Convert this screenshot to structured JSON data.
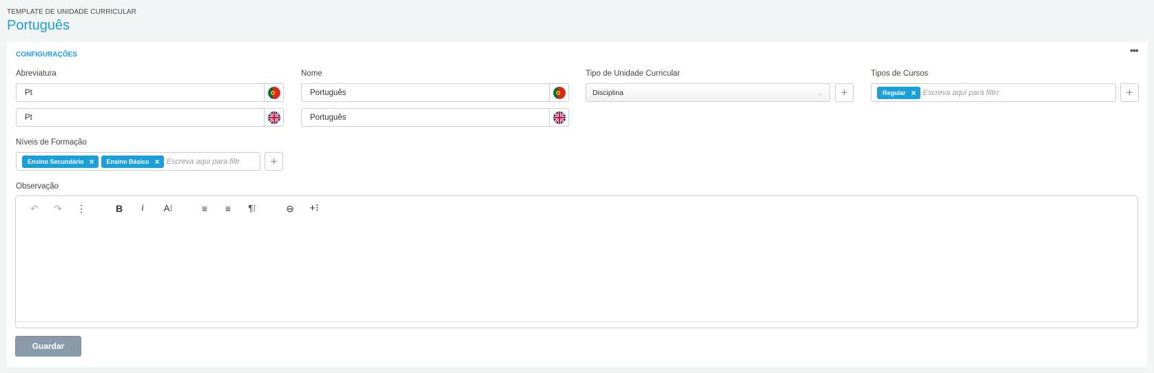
{
  "header": {
    "eyebrow": "TEMPLATE DE UNIDADE CURRICULAR",
    "title": "Português"
  },
  "section": {
    "title": "CONFIGURAÇÕES",
    "menu_icon": "more-horizontal-icon"
  },
  "abreviatura": {
    "label": "Abreviatura",
    "pt_value": "Pt",
    "en_value": "Pt"
  },
  "nome": {
    "label": "Nome",
    "pt_value": "Português",
    "en_value": "Português"
  },
  "tipo_unidade": {
    "label": "Tipo de Unidade Curricular",
    "selected": "Disciplina"
  },
  "tipos_cursos": {
    "label": "Tipos de Cursos",
    "tags": [
      "Regular"
    ],
    "placeholder": "Escreva aqui para filtrar"
  },
  "niveis_formacao": {
    "label": "Níveis de Formação",
    "tags": [
      "Ensino Secundário",
      "Ensino Básico"
    ],
    "placeholder": "Escreva aqui para filtrar"
  },
  "observacao": {
    "label": "Observação",
    "toolbar": {
      "undo": "↶",
      "redo": "↷",
      "more": "⋮",
      "bold": "B",
      "italic": "i",
      "font_size": "A⁝",
      "align": "≡",
      "list": "≡",
      "paragraph": "¶⁝",
      "link": "⊖",
      "insert": "+⁝"
    }
  },
  "actions": {
    "save_label": "Guardar"
  },
  "colors": {
    "accent": "#1a9fd9",
    "save_button": "#8a9aa8",
    "background": "#f3f6f7"
  }
}
